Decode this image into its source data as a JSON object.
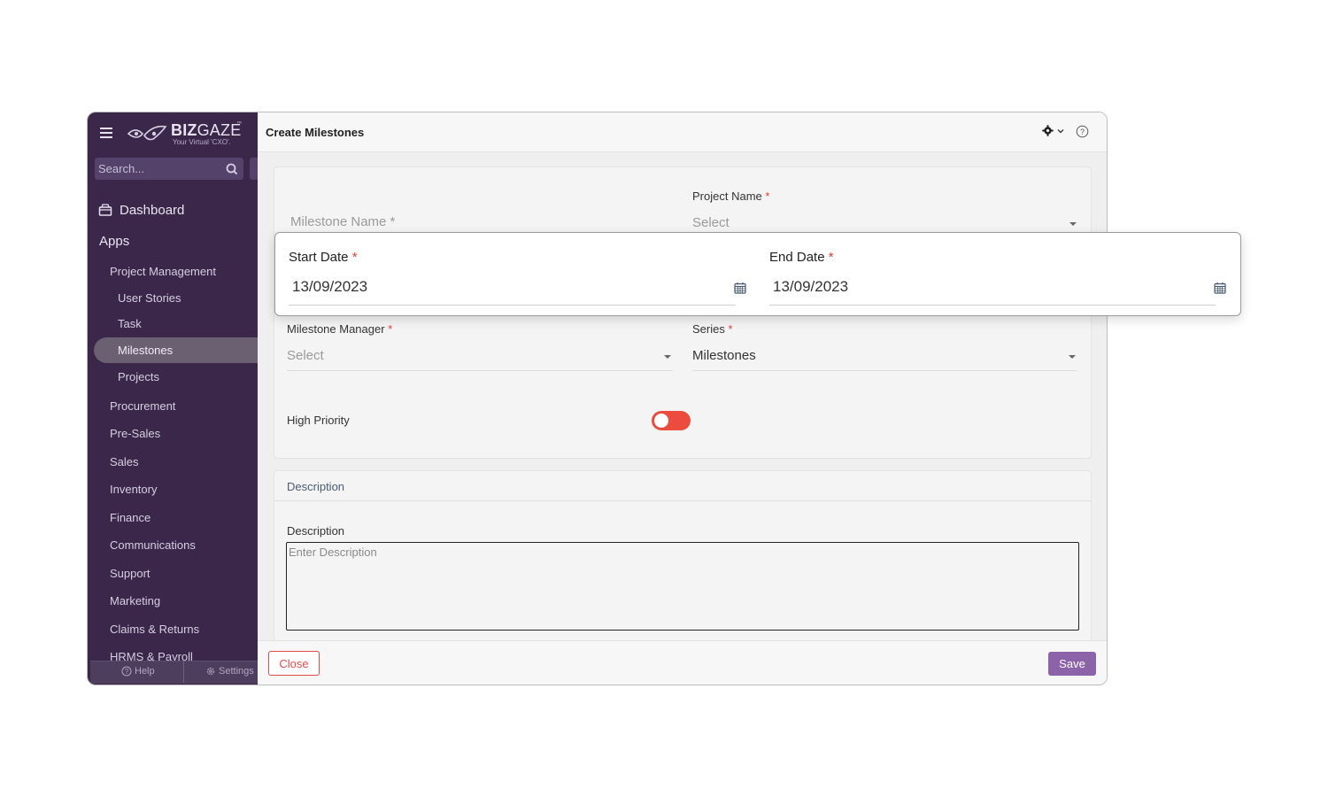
{
  "sidebar": {
    "brand": {
      "name_bold": "BIZ",
      "name_light": "GAZE",
      "trademark": "™",
      "tagline": "Your Virtual 'CXO'."
    },
    "search_placeholder": "Search...",
    "dashboard_label": "Dashboard",
    "apps_label": "Apps",
    "items": [
      {
        "label": "Project Management"
      },
      {
        "label": "User Stories"
      },
      {
        "label": "Task"
      },
      {
        "label": "Milestones",
        "active": true
      },
      {
        "label": "Projects"
      },
      {
        "label": "Procurement"
      },
      {
        "label": "Pre-Sales"
      },
      {
        "label": "Sales"
      },
      {
        "label": "Inventory"
      },
      {
        "label": "Finance"
      },
      {
        "label": "Communications"
      },
      {
        "label": "Support"
      },
      {
        "label": "Marketing"
      },
      {
        "label": "Claims & Returns"
      },
      {
        "label": "HRMS & Payroll"
      }
    ],
    "footer": {
      "help_label": "Help",
      "settings_label": "Settings"
    }
  },
  "header": {
    "title": "Create Milestones"
  },
  "form": {
    "milestone_name": {
      "placeholder": "Milestone Name *"
    },
    "project_name": {
      "label": "Project Name",
      "required_mark": "*",
      "value": "Select"
    },
    "milestone_manager": {
      "label": "Milestone Manager",
      "required_mark": "*",
      "value": "Select"
    },
    "series": {
      "label": "Series",
      "required_mark": "*",
      "value": "Milestones"
    },
    "high_priority": {
      "label": "High Priority",
      "on": false
    }
  },
  "date_popup": {
    "start_date": {
      "label": "Start Date",
      "required_mark": "*",
      "value": "13/09/2023"
    },
    "end_date": {
      "label": "End Date",
      "required_mark": "*",
      "value": "13/09/2023"
    }
  },
  "description": {
    "section_title": "Description",
    "label": "Description",
    "placeholder": "Enter Description"
  },
  "footer": {
    "close_label": "Close",
    "save_label": "Save"
  },
  "colors": {
    "sidebar_bg": "#3a2749",
    "accent": "#8c62a8",
    "danger": "#e04b4b",
    "toggle": "#ec4c3d"
  }
}
